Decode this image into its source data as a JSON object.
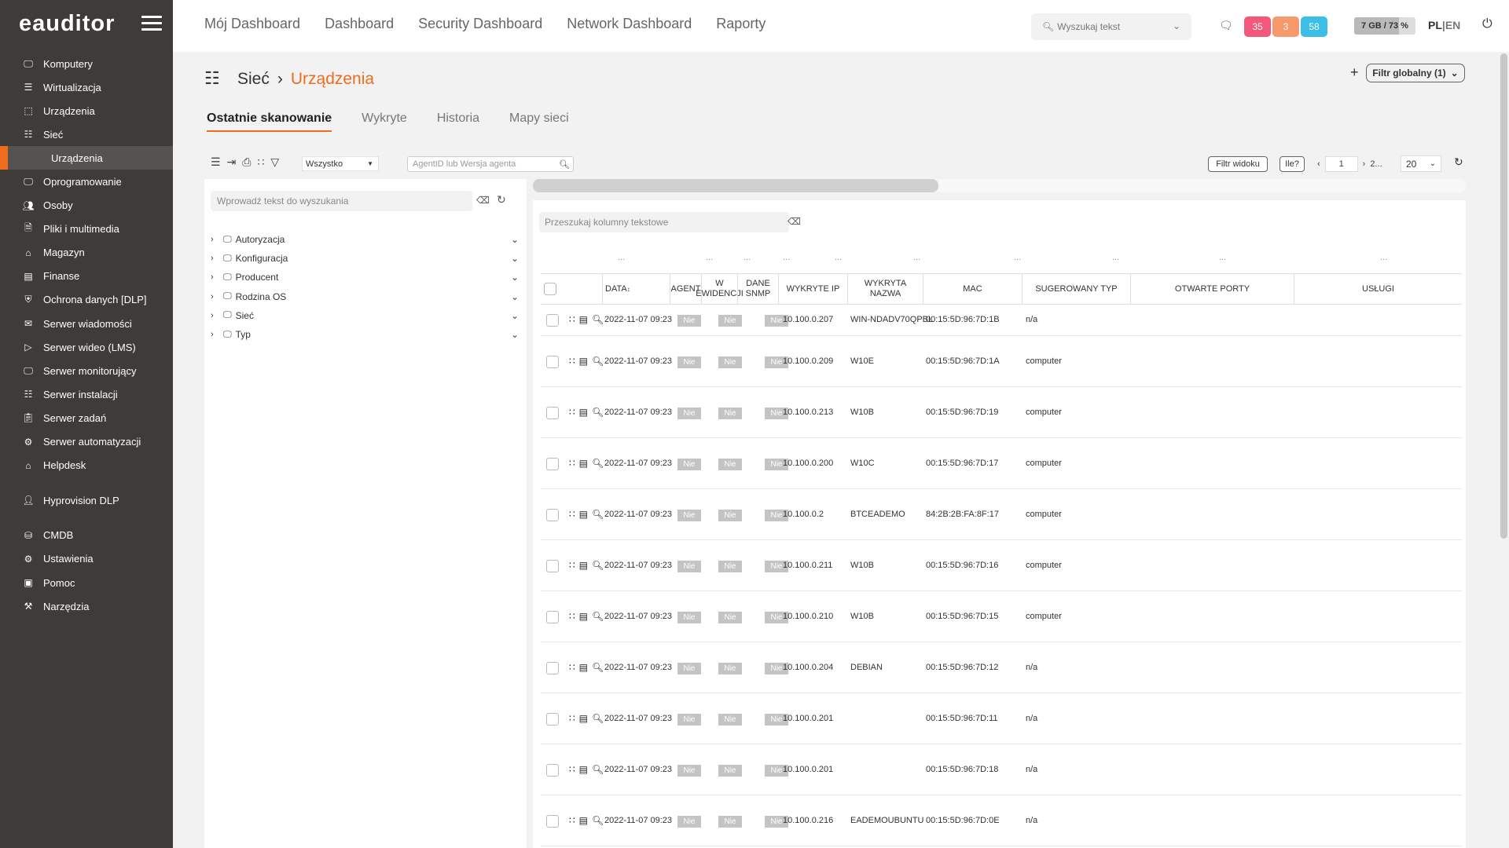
{
  "brand": {
    "logo": "eauditor"
  },
  "sidebar": {
    "items": [
      {
        "label": "Komputery",
        "icon": "monitor-icon"
      },
      {
        "label": "Wirtualizacja",
        "icon": "server-icon"
      },
      {
        "label": "Urządzenia",
        "icon": "devices-icon"
      },
      {
        "label": "Sieć",
        "icon": "network-icon"
      },
      {
        "label": "Urządzenia",
        "icon": "",
        "sub": true
      },
      {
        "label": "Oprogramowanie",
        "icon": "monitor-icon"
      },
      {
        "label": "Osoby",
        "icon": "users-icon"
      },
      {
        "label": "Pliki i multimedia",
        "icon": "file-icon"
      },
      {
        "label": "Magazyn",
        "icon": "warehouse-icon"
      },
      {
        "label": "Finanse",
        "icon": "wallet-icon"
      },
      {
        "label": "Ochrona danych [DLP]",
        "icon": "shield-icon"
      },
      {
        "label": "Serwer wiadomości",
        "icon": "mail-icon"
      },
      {
        "label": "Serwer wideo (LMS)",
        "icon": "video-icon"
      },
      {
        "label": "Serwer monitorujący",
        "icon": "monitor-chart-icon"
      },
      {
        "label": "Serwer instalacji",
        "icon": "network-icon"
      },
      {
        "label": "Serwer zadań",
        "icon": "clipboard-icon"
      },
      {
        "label": "Serwer automatyzacji",
        "icon": "gear-icon"
      },
      {
        "label": "Helpdesk",
        "icon": "home-icon"
      },
      {
        "label": "Hyprovision DLP",
        "icon": "user-key-icon",
        "gap": true
      },
      {
        "label": "CMDB",
        "icon": "database-icon",
        "gap": true
      },
      {
        "label": "Ustawienia",
        "icon": "gear-icon"
      },
      {
        "label": "Pomoc",
        "icon": "help-icon"
      },
      {
        "label": "Narzędzia",
        "icon": "tools-icon"
      }
    ]
  },
  "topnav": [
    "Mój Dashboard",
    "Dashboard",
    "Security Dashboard",
    "Network Dashboard",
    "Raporty"
  ],
  "header": {
    "search_placeholder": "Wyszukaj tekst",
    "badges": [
      {
        "value": "35",
        "color": "#f3587a"
      },
      {
        "value": "3",
        "color": "#f79a6b"
      },
      {
        "value": "58",
        "color": "#3bbfe6"
      }
    ],
    "storage": "7 GB / 73 %",
    "storage_pct": 73,
    "lang_pl": "PL",
    "lang_sep": "|",
    "lang_en": "EN"
  },
  "page": {
    "section": "Sieć",
    "current": "Urządzenia",
    "global_filter": "Filtr globalny (1)"
  },
  "tabs": [
    "Ostatnie skanowanie",
    "Wykryte",
    "Historia",
    "Mapy sieci"
  ],
  "toolbar": {
    "select_value": "Wszystko",
    "agent_search_placeholder": "AgentID lub Wersja agenta",
    "view_filter": "Filtr widoku",
    "how_many": "Ile?",
    "page": "1",
    "page_next": "2...",
    "per_page": "20"
  },
  "left": {
    "search_placeholder": "Wprowadź tekst do wyszukania",
    "tree": [
      "Autoryzacja",
      "Konfiguracja",
      "Producent",
      "Rodzina OS",
      "Sieć",
      "Typ"
    ]
  },
  "right": {
    "search_placeholder": "Przeszukaj kolumny tekstowe"
  },
  "table": {
    "columns": {
      "date": "DATA",
      "agent": "AGENT",
      "w_ewidencji": "W EWIDENCJI",
      "dane_snmp": "DANE SNMP",
      "ip": "WYKRYTE IP",
      "name": "WYKRYTA NAZWA",
      "mac": "MAC",
      "type": "SUGEROWANY TYP",
      "ports": "OTWARTE PORTY",
      "services": "USŁUGI"
    },
    "nie": "Nie",
    "rows": [
      {
        "date": "2022-11-07 09:23",
        "ip": "10.100.0.207",
        "name": "WIN-NDADV70QPBL",
        "mac": "00:15:5D:96:7D:1B",
        "type": "n/a"
      },
      {
        "date": "2022-11-07 09:23",
        "ip": "10.100.0.209",
        "name": "W10E",
        "mac": "00:15:5D:96:7D:1A",
        "type": "computer"
      },
      {
        "date": "2022-11-07 09:23",
        "ip": "10.100.0.213",
        "name": "W10B",
        "mac": "00:15:5D:96:7D:19",
        "type": "computer"
      },
      {
        "date": "2022-11-07 09:23",
        "ip": "10.100.0.200",
        "name": "W10C",
        "mac": "00:15:5D:96:7D:17",
        "type": "computer"
      },
      {
        "date": "2022-11-07 09:23",
        "ip": "10.100.0.2",
        "name": "BTCEADEMO",
        "mac": "84:2B:2B:FA:8F:17",
        "type": "computer"
      },
      {
        "date": "2022-11-07 09:23",
        "ip": "10.100.0.211",
        "name": "W10B",
        "mac": "00:15:5D:96:7D:16",
        "type": "computer"
      },
      {
        "date": "2022-11-07 09:23",
        "ip": "10.100.0.210",
        "name": "W10B",
        "mac": "00:15:5D:96:7D:15",
        "type": "computer"
      },
      {
        "date": "2022-11-07 09:23",
        "ip": "10.100.0.204",
        "name": "DEBIAN",
        "mac": "00:15:5D:96:7D:12",
        "type": "n/a"
      },
      {
        "date": "2022-11-07 09:23",
        "ip": "10.100.0.201",
        "name": "",
        "mac": "00:15:5D:96:7D:11",
        "type": "n/a"
      },
      {
        "date": "2022-11-07 09:23",
        "ip": "10.100.0.201",
        "name": "",
        "mac": "00:15:5D:96:7D:18",
        "type": "n/a"
      },
      {
        "date": "2022-11-07 09:23",
        "ip": "10.100.0.216",
        "name": "EADEMOUBUNTU",
        "mac": "00:15:5D:96:7D:0E",
        "type": "n/a"
      }
    ]
  }
}
